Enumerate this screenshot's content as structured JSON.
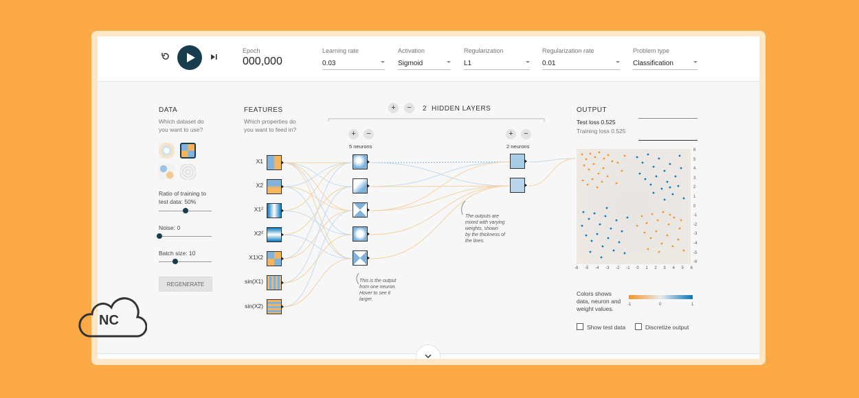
{
  "controls": {
    "epoch_label": "Epoch",
    "epoch_value": "000,000",
    "learning_rate": {
      "label": "Learning rate",
      "value": "0.03"
    },
    "activation": {
      "label": "Activation",
      "value": "Sigmoid"
    },
    "regularization": {
      "label": "Regularization",
      "value": "L1"
    },
    "regularization_rate": {
      "label": "Regularization rate",
      "value": "0.01"
    },
    "problem_type": {
      "label": "Problem type",
      "value": "Classification"
    }
  },
  "data": {
    "header": "DATA",
    "question": [
      "Which dataset do",
      "you want to use?"
    ],
    "ratio_label": [
      "Ratio of training to",
      "test data:  50%"
    ],
    "ratio_value": 50,
    "noise_label": "Noise:  0",
    "noise_value": 0,
    "batch_label": "Batch size:  10",
    "batch_value": 10,
    "regenerate": "REGENERATE"
  },
  "features": {
    "header": "FEATURES",
    "question": [
      "Which properties do",
      "you want to feed in?"
    ],
    "items": [
      "X1",
      "X2",
      "X1²",
      "X2²",
      "X1X2",
      "sin(X1)",
      "sin(X2)"
    ]
  },
  "hidden": {
    "plus": "+",
    "minus": "−",
    "count": "2",
    "label": "HIDDEN LAYERS",
    "layer1": "5 neurons",
    "layer2": "2 neurons"
  },
  "notes": {
    "neuron": [
      "This is the output",
      "from one neuron.",
      "Hover to see it",
      "larger."
    ],
    "weights": [
      "The outputs are",
      "mixed with varying",
      "weights, shown",
      "by the thickness of",
      "the lines."
    ]
  },
  "output": {
    "header": "OUTPUT",
    "test_loss": "Test loss 0.525",
    "training_loss": "Training loss 0.525",
    "y_ticks": [
      "6",
      "5",
      "4",
      "3",
      "2",
      "1",
      "0",
      "-1",
      "-2",
      "-3",
      "-4",
      "-5",
      "-6"
    ],
    "x_ticks": [
      "-6",
      "-5",
      "-4",
      "-3",
      "-2",
      "-1",
      "0",
      "1",
      "2",
      "3",
      "4",
      "5",
      "6"
    ],
    "colors_text": [
      "Colors shows",
      "data, neuron and",
      "weight values."
    ],
    "scale_labels": [
      "-1",
      "0",
      "1"
    ],
    "show_test": "Show test data",
    "discretize": "Discretize output"
  },
  "logo_text": "NC",
  "colors": {
    "orange": "#f59322",
    "blue": "#0877bd",
    "dark": "#183d4e"
  }
}
